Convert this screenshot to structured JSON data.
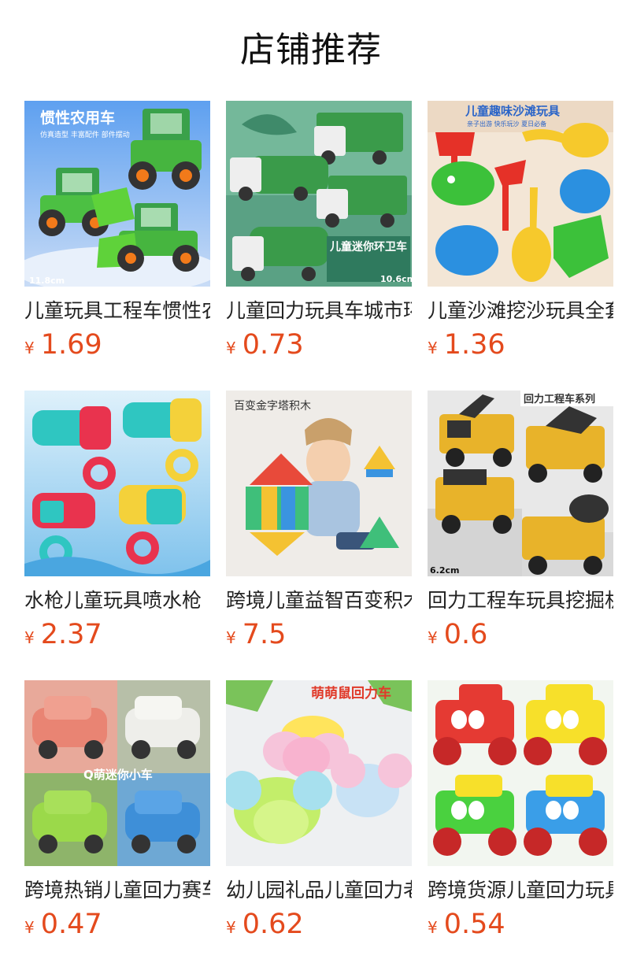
{
  "page": {
    "title": "店铺推荐"
  },
  "currency_symbol": "¥",
  "colors": {
    "price": "#e44a1d",
    "title": "#111111"
  },
  "products": [
    {
      "name": "儿童玩具工程车惯性农用车",
      "price": "1.69",
      "image": {
        "heading": "惯性农用车",
        "subtitle": "仿真造型  丰富配件  部件摆动",
        "size": "11.8cm",
        "icon": "green-bulldozer-toy"
      }
    },
    {
      "name": "儿童回力玩具车城市环卫车",
      "price": "0.73",
      "image": {
        "heading": "儿童迷你环卫车",
        "size": "10.6cm",
        "icon": "sanitation-truck-toy"
      }
    },
    {
      "name": "儿童沙滩挖沙玩具全套",
      "price": "1.36",
      "image": {
        "heading": "儿童趣味沙滩玩具",
        "subtitle": "亲子出游  快乐玩沙  夏日必备",
        "icon": "beach-sand-toys"
      }
    },
    {
      "name": "水枪儿童玩具喷水枪",
      "price": "2.37",
      "image": {
        "icon": "water-gun-toy"
      }
    },
    {
      "name": "跨境儿童益智百变积木",
      "price": "7.5",
      "image": {
        "heading": "百变金字塔积木",
        "icon": "pyramid-blocks-toy"
      }
    },
    {
      "name": "回力工程车玩具挖掘机",
      "price": "0.6",
      "image": {
        "heading": "回力工程车系列",
        "size": "6.2cm",
        "icon": "yellow-construction-truck"
      }
    },
    {
      "name": "跨境热销儿童回力赛车",
      "price": "0.47",
      "image": {
        "heading": "Q萌迷你小车",
        "icon": "mini-car-toy"
      }
    },
    {
      "name": "幼儿园礼品儿童回力老鼠",
      "price": "0.62",
      "image": {
        "heading": "萌萌鼠回力车",
        "icon": "mouse-car-toy"
      }
    },
    {
      "name": "跨境货源儿童回力玩具车",
      "price": "0.54",
      "image": {
        "icon": "cartoon-truck-toy"
      }
    }
  ]
}
